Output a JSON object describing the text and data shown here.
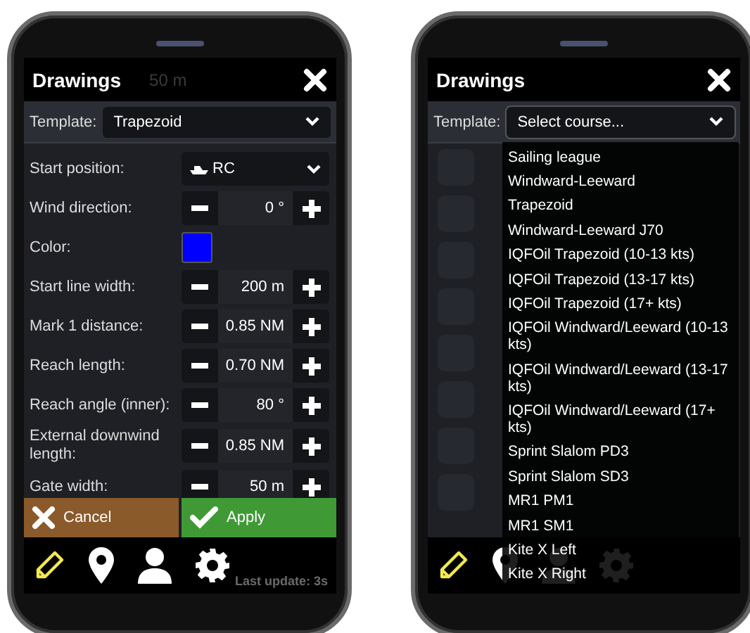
{
  "phones": [
    {
      "kind": "form",
      "title": "Drawings",
      "map_label": "50 m",
      "template": {
        "label": "Template:",
        "value": "Trapezoid",
        "expanded": false
      },
      "fields": [
        {
          "kind": "select",
          "label": "Start position:",
          "value": "RC"
        },
        {
          "kind": "stepper",
          "label": "Wind direction:",
          "value": "0 °"
        },
        {
          "kind": "color",
          "label": "Color:",
          "color": "#0000ff"
        },
        {
          "kind": "stepper",
          "label": "Start line width:",
          "value": "200 m"
        },
        {
          "kind": "stepper",
          "label": "Mark 1 distance:",
          "value": "0.85 NM"
        },
        {
          "kind": "stepper",
          "label": "Reach length:",
          "value": "0.70 NM"
        },
        {
          "kind": "stepper",
          "label": "Reach angle (inner):",
          "value": "80 °"
        },
        {
          "kind": "stepper",
          "label": "External downwind length:",
          "value": "0.85 NM"
        },
        {
          "kind": "stepper",
          "label": "Gate width:",
          "value": "50 m"
        }
      ],
      "buttons": [
        {
          "kind": "cancel",
          "label": "Cancel"
        },
        {
          "kind": "apply",
          "label": "Apply"
        }
      ],
      "nav": [
        {
          "kind": "pencil",
          "selected": true
        },
        {
          "kind": "pin",
          "selected": false
        },
        {
          "kind": "person",
          "selected": false
        },
        {
          "kind": "gear",
          "selected": false
        }
      ],
      "status": "Last update: 3s"
    },
    {
      "kind": "picker",
      "title": "Drawings",
      "template": {
        "label": "Template:",
        "value": "Select course...",
        "expanded": true
      },
      "options": [
        "Sailing league",
        "Windward-Leeward",
        "Trapezoid",
        "Windward-Leeward J70",
        "IQFOil Trapezoid (10-13 kts)",
        "IQFOil Trapezoid (13-17 kts)",
        "IQFOil Trapezoid (17+ kts)",
        "IQFOil Windward/Leeward (10-13 kts)",
        "IQFOil Windward/Leeward (13-17 kts)",
        "IQFOil Windward/Leeward (17+ kts)",
        "Sprint Slalom PD3",
        "Sprint Slalom SD3",
        "MR1 PM1",
        "MR1 SM1",
        "Kite X Left",
        "Kite X Right"
      ],
      "nav": [
        {
          "kind": "pencil",
          "selected": true
        },
        {
          "kind": "pin",
          "selected": false
        },
        {
          "kind": "person",
          "selected": false
        },
        {
          "kind": "gear",
          "selected": false
        }
      ]
    }
  ]
}
